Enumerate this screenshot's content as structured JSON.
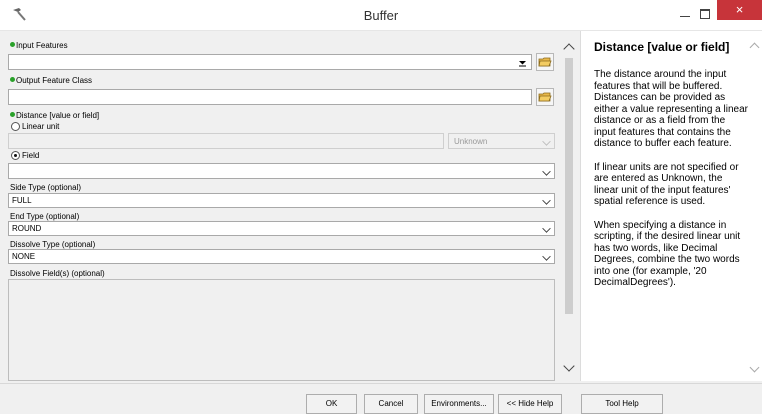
{
  "window": {
    "title": "Buffer",
    "close_glyph": "×"
  },
  "form": {
    "input_features": {
      "label": "Input Features",
      "value": ""
    },
    "output_feature_class": {
      "label": "Output Feature Class",
      "value": ""
    },
    "distance": {
      "label": "Distance [value or field]",
      "linear_unit_label": "Linear unit",
      "linear_unit_value": "",
      "unit_select_value": "Unknown",
      "field_label": "Field",
      "field_value": "",
      "selected_option": "Field"
    },
    "side_type": {
      "label": "Side Type (optional)",
      "value": "FULL"
    },
    "end_type": {
      "label": "End Type (optional)",
      "value": "ROUND"
    },
    "dissolve_type": {
      "label": "Dissolve Type (optional)",
      "value": "NONE"
    },
    "dissolve_fields": {
      "label": "Dissolve Field(s) (optional)"
    }
  },
  "help": {
    "title": "Distance [value or field]",
    "paragraphs": [
      "The distance around the input features that will be buffered. Distances can be provided as either a value representing a linear distance or as a field from the input features that contains the distance to buffer each feature.",
      "If linear units are not specified or are entered as Unknown, the linear unit of the input features' spatial reference is used.",
      "When specifying a distance in scripting, if the desired linear unit has two words, like Decimal Degrees, combine the two words into one (for example, '20 DecimalDegrees')."
    ]
  },
  "buttons": {
    "ok": "OK",
    "cancel": "Cancel",
    "environments": "Environments...",
    "hide_help": "<< Hide Help",
    "tool_help": "Tool Help"
  },
  "icons": {
    "app": "hammer-icon",
    "required": "green-dot-icon",
    "browse": "folder-icon"
  },
  "colors": {
    "close_button": "#c7343a",
    "required_dot": "#2aa12a"
  }
}
